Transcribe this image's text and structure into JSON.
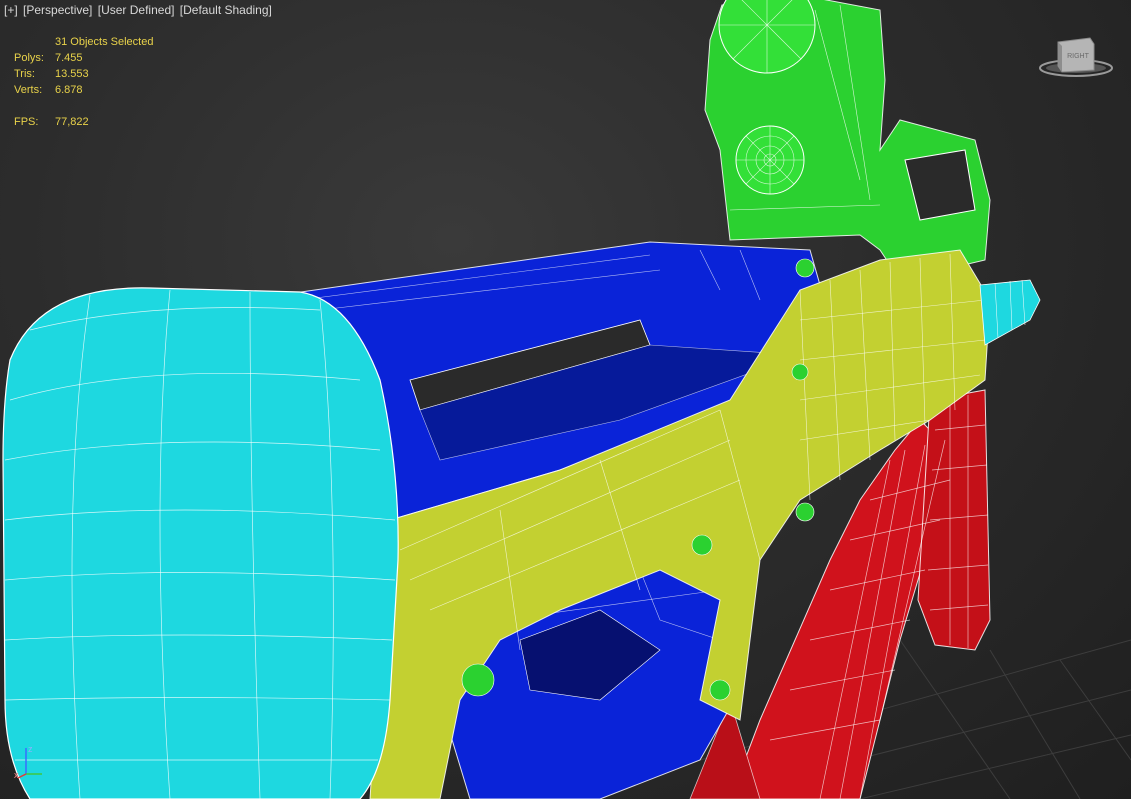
{
  "viewport": {
    "menu": {
      "plus": "[+]",
      "view": "[Perspective]",
      "shading_preset": "[User Defined]",
      "shading": "[Default Shading]"
    },
    "stats": {
      "selection": "31 Objects Selected",
      "polys_label": "Polys:",
      "polys": "7.455",
      "tris_label": "Tris:",
      "tris": "13.553",
      "verts_label": "Verts:",
      "verts": "6.878",
      "fps_label": "FPS:",
      "fps": "77,822"
    },
    "viewcube": {
      "face_label": "RIGHT"
    },
    "axis_tripod": {
      "z": "z",
      "x": "x"
    },
    "colors": {
      "background": "#2c2c2c",
      "stats_text": "#e8d24a",
      "selection_outline": "#6ff2f2",
      "stock": "#1ed8e0",
      "receiver": "#0a23d8",
      "body": "#c3d031",
      "sight": "#2bd130",
      "magazine": "#d0121c",
      "grid": "#3c3c3c"
    }
  }
}
